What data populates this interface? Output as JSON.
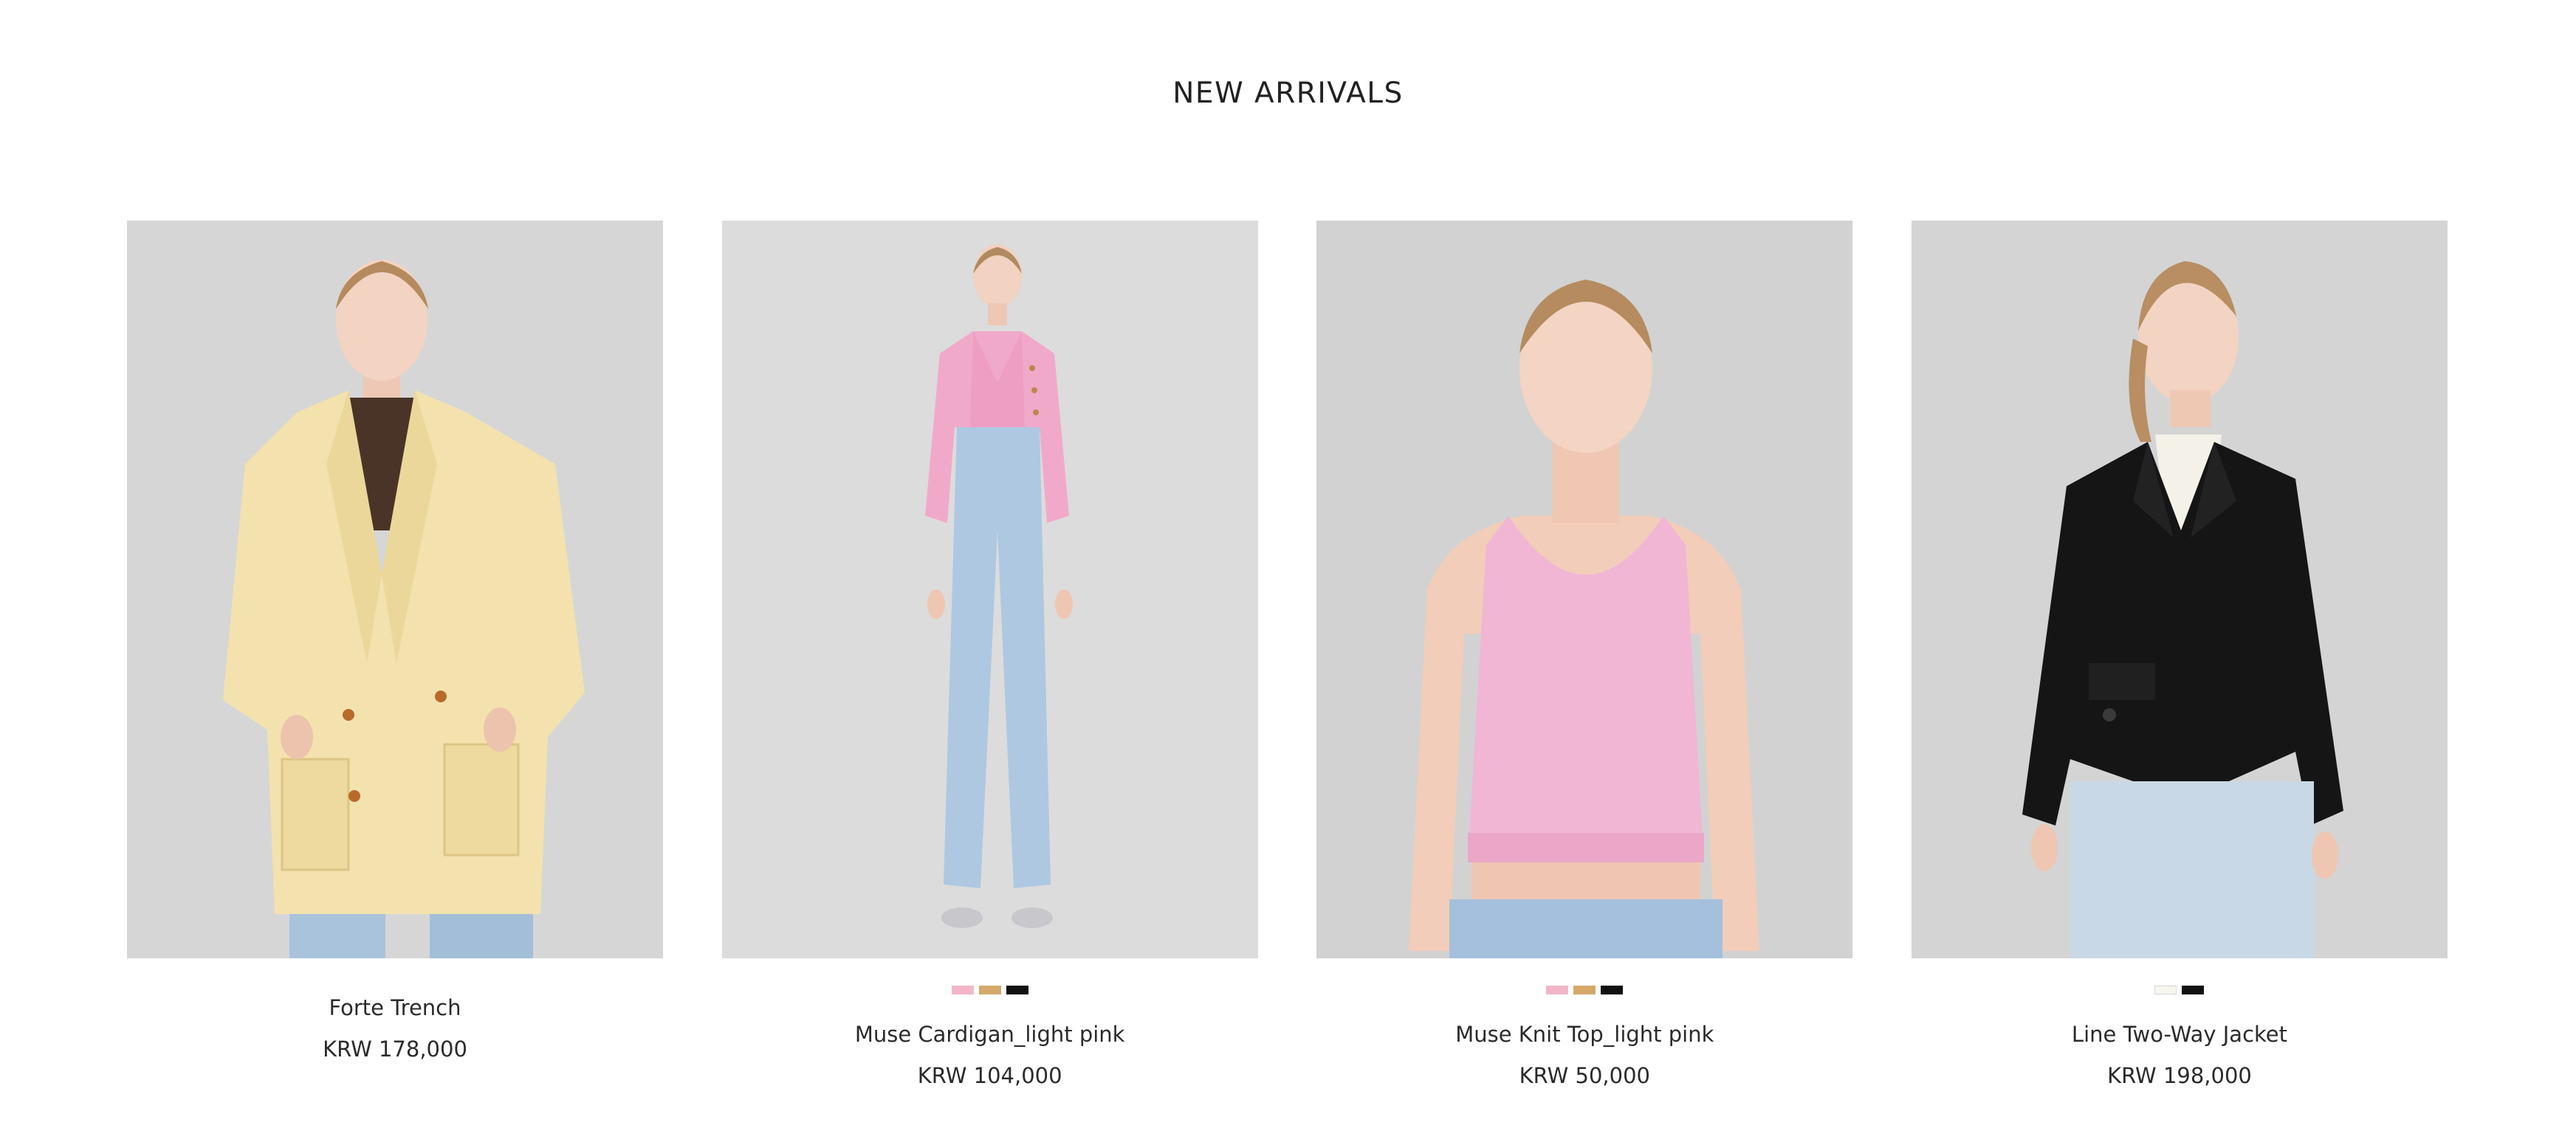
{
  "section": {
    "title": "NEW ARRIVALS"
  },
  "products": [
    {
      "name": "Forte Trench",
      "price": "KRW 178,000",
      "swatches": []
    },
    {
      "name": "Muse Cardigan_light pink",
      "price": "KRW 104,000",
      "swatches": [
        "#f2b6c8",
        "#d4a96a",
        "#111111"
      ]
    },
    {
      "name": "Muse Knit Top_light pink",
      "price": "KRW 50,000",
      "swatches": [
        "#f2b6c8",
        "#d4a96a",
        "#111111"
      ]
    },
    {
      "name": "Line Two-Way Jacket",
      "price": "KRW 198,000",
      "swatches": [
        "#f7f6ee",
        "#111111"
      ]
    }
  ]
}
